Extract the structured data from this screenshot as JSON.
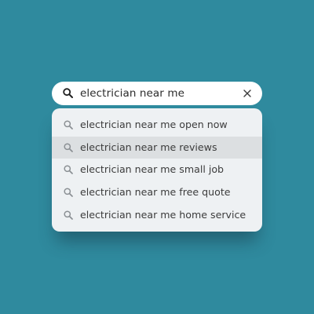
{
  "colors": {
    "background": "#2f8a9e",
    "search_bar": "#ffffff",
    "dropdown": "#eef1f3",
    "highlight": "#dcdfe1",
    "text": "#3c3c3c",
    "icon": "#8a8f93"
  },
  "search": {
    "query": "electrician near me",
    "lead_icon": "search-icon",
    "clear_icon": "close-icon"
  },
  "suggestions": [
    {
      "label": "electrician near me open now",
      "icon": "search-icon",
      "highlighted": false
    },
    {
      "label": "electrician near me reviews",
      "icon": "search-icon",
      "highlighted": true
    },
    {
      "label": "electrician near me small job",
      "icon": "search-icon",
      "highlighted": false
    },
    {
      "label": "electrician near me free quote",
      "icon": "search-icon",
      "highlighted": false
    },
    {
      "label": "electrician near me home service",
      "icon": "search-icon",
      "highlighted": false
    }
  ]
}
